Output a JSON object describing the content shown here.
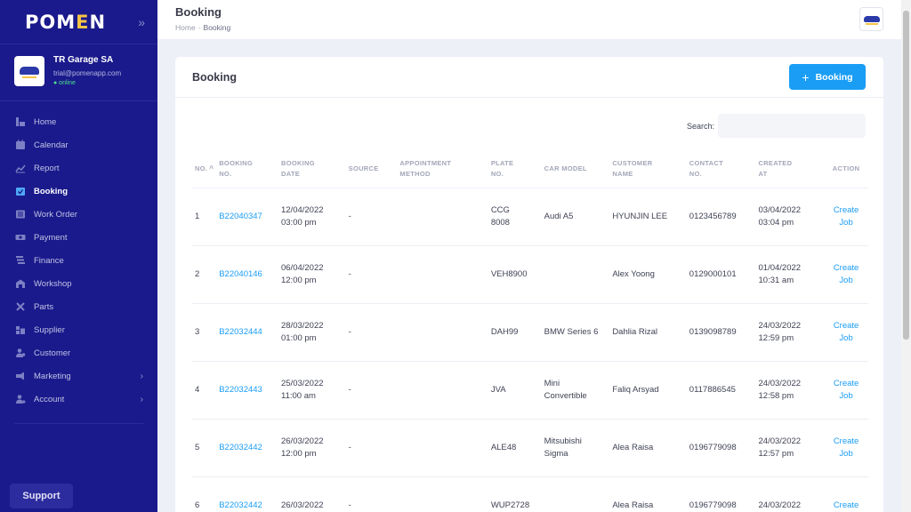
{
  "brand": {
    "logo_main": "POM",
    "logo_accent": "E",
    "logo_tail": "N",
    "collapse_icon": "chevrons-right-icon"
  },
  "profile": {
    "name": "TR Garage SA",
    "email": "trial@pomenapp.com",
    "status": "● online"
  },
  "sidebar": {
    "items": [
      {
        "label": "Home",
        "icon": "home-icon"
      },
      {
        "label": "Calendar",
        "icon": "calendar-icon"
      },
      {
        "label": "Report",
        "icon": "chart-icon"
      },
      {
        "label": "Booking",
        "icon": "calendar-check-icon",
        "active": true
      },
      {
        "label": "Work Order",
        "icon": "list-icon"
      },
      {
        "label": "Payment",
        "icon": "money-icon"
      },
      {
        "label": "Finance",
        "icon": "finance-icon"
      },
      {
        "label": "Workshop",
        "icon": "workshop-icon"
      },
      {
        "label": "Parts",
        "icon": "tools-icon"
      },
      {
        "label": "Supplier",
        "icon": "truck-icon"
      },
      {
        "label": "Customer",
        "icon": "users-icon"
      },
      {
        "label": "Marketing",
        "icon": "megaphone-icon",
        "chevron": "›"
      },
      {
        "label": "Account",
        "icon": "user-gear-icon",
        "chevron": "›"
      }
    ],
    "support_label": "Support"
  },
  "header": {
    "title": "Booking",
    "breadcrumb_home": "Home",
    "breadcrumb_sep": "-",
    "breadcrumb_current": "Booking"
  },
  "card": {
    "title": "Booking",
    "add_button_plus": "+",
    "add_button_label": "Booking"
  },
  "search": {
    "label": "Search:",
    "value": ""
  },
  "table": {
    "headers": [
      {
        "line1": "NO.",
        "line2": "",
        "sort": "^"
      },
      {
        "line1": "BOOKING",
        "line2": "NO."
      },
      {
        "line1": "BOOKING",
        "line2": "DATE"
      },
      {
        "line1": "SOURCE",
        "line2": ""
      },
      {
        "line1": "APPOINTMENT",
        "line2": "METHOD"
      },
      {
        "line1": "PLATE",
        "line2": "NO."
      },
      {
        "line1": "CAR MODEL",
        "line2": ""
      },
      {
        "line1": "CUSTOMER",
        "line2": "NAME"
      },
      {
        "line1": "CONTACT",
        "line2": "NO."
      },
      {
        "line1": "CREATED",
        "line2": "AT"
      },
      {
        "line1": "ACTION",
        "line2": ""
      }
    ],
    "rows": [
      {
        "no": "1",
        "booking_no": "B22040347",
        "date1": "12/04/2022",
        "date2": "03:00 pm",
        "source": "-",
        "method": "",
        "plate1": "CCG",
        "plate2": "8008",
        "model1": "Audi A5",
        "model2": "",
        "customer": "HYUNJIN LEE",
        "contact": "0123456789",
        "created1": "03/04/2022",
        "created2": "03:04 pm",
        "action1": "Create",
        "action2": "Job"
      },
      {
        "no": "2",
        "booking_no": "B22040146",
        "date1": "06/04/2022",
        "date2": "12:00 pm",
        "source": "-",
        "method": "",
        "plate1": "VEH8900",
        "plate2": "",
        "model1": "",
        "model2": "",
        "customer": "Alex Yoong",
        "contact": "0129000101",
        "created1": "01/04/2022",
        "created2": "10:31 am",
        "action1": "Create",
        "action2": "Job"
      },
      {
        "no": "3",
        "booking_no": "B22032444",
        "date1": "28/03/2022",
        "date2": "01:00 pm",
        "source": "-",
        "method": "",
        "plate1": "DAH99",
        "plate2": "",
        "model1": "BMW Series 6",
        "model2": "",
        "customer": "Dahlia Rizal",
        "contact": "0139098789",
        "created1": "24/03/2022",
        "created2": "12:59 pm",
        "action1": "Create",
        "action2": "Job"
      },
      {
        "no": "4",
        "booking_no": "B22032443",
        "date1": "25/03/2022",
        "date2": "11:00 am",
        "source": "-",
        "method": "",
        "plate1": "JVA",
        "plate2": "",
        "model1": "Mini",
        "model2": "Convertible",
        "customer": "Faliq Arsyad",
        "contact": "0117886545",
        "created1": "24/03/2022",
        "created2": "12:58 pm",
        "action1": "Create",
        "action2": "Job"
      },
      {
        "no": "5",
        "booking_no": "B22032442",
        "date1": "26/03/2022",
        "date2": "12:00 pm",
        "source": "-",
        "method": "",
        "plate1": "ALE48",
        "plate2": "",
        "model1": "Mitsubishi",
        "model2": "Sigma",
        "customer": "Alea Raisa",
        "contact": "0196779098",
        "created1": "24/03/2022",
        "created2": "12:57 pm",
        "action1": "Create",
        "action2": "Job"
      },
      {
        "no": "6",
        "booking_no": "B22032442",
        "date1": "26/03/2022",
        "date2": "",
        "source": "-",
        "method": "",
        "plate1": "WUP2728",
        "plate2": "",
        "model1": "",
        "model2": "",
        "customer": "Alea Raisa",
        "contact": "0196779098",
        "created1": "24/03/2022",
        "created2": "",
        "action1": "Create",
        "action2": ""
      }
    ]
  }
}
